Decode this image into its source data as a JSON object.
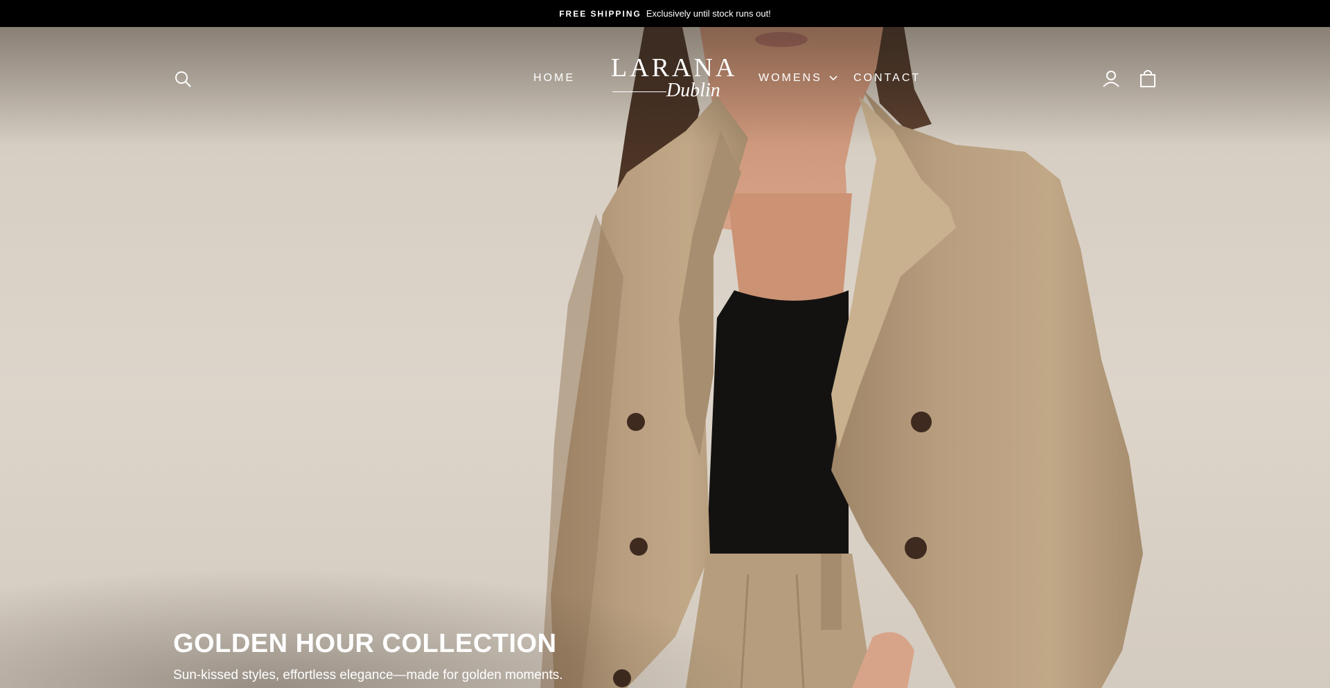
{
  "announcement": {
    "bold": "FREE SHIPPING",
    "text": "Exclusively until stock runs out!"
  },
  "header": {
    "logo": {
      "main": "LARANA",
      "sub": "Dublin"
    },
    "nav": {
      "home": "HOME",
      "womens": "WOMENS",
      "contact": "CONTACT"
    },
    "icons": [
      "search-icon",
      "user-icon",
      "cart-icon",
      "chevron-down-icon"
    ]
  },
  "hero": {
    "title": "GOLDEN HOUR COLLECTION",
    "subtitle": "Sun-kissed styles, effortless elegance—made for golden moments."
  },
  "colors": {
    "announcement_bg": "#000000",
    "text_light": "#ffffff",
    "blazer": "#b39a7b",
    "top": "#121110",
    "background": "#d9d1c7"
  }
}
